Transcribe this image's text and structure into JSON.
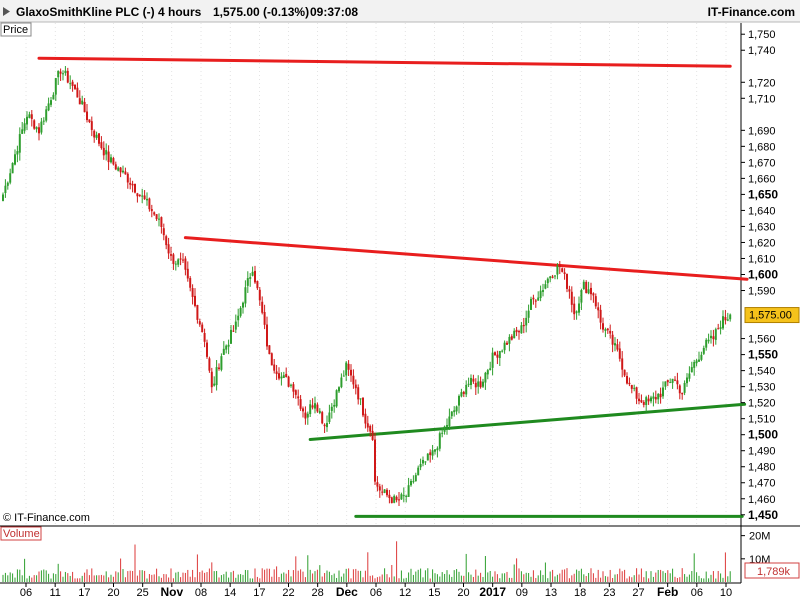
{
  "header": {
    "instrument": "GlaxoSmithKline PLC (-)",
    "timeframe": "4 hours",
    "change": "1,575.00 (-0.13%)",
    "time": "09:37:08",
    "brand": "IT-Finance.com"
  },
  "panels": {
    "price_label": "Price",
    "volume_label": "Volume"
  },
  "copyright": "© IT-Finance.com",
  "colors": {
    "up_candle": "#2e9e2e",
    "down_candle": "#d01818",
    "resistance": "#e81e1e",
    "support": "#1f8a1f",
    "last_price_bg": "#f5c21b",
    "volume_bar": "#dd3a3a",
    "volume_bar_up": "#2e9e2e",
    "volume_tag_border": "#d04040",
    "grid": "#c8c8c8"
  },
  "icons": {
    "scroll_arrow": "triangle-right-icon"
  },
  "chart_data": {
    "type": "candlestick",
    "price_axis": {
      "ylim": [
        1443,
        1757
      ],
      "ticks": [
        {
          "value": 1750,
          "label": "1,750",
          "bold": false
        },
        {
          "value": 1740,
          "label": "1,740",
          "bold": false
        },
        {
          "value": 1720,
          "label": "1,720",
          "bold": false
        },
        {
          "value": 1710,
          "label": "1,710",
          "bold": false
        },
        {
          "value": 1690,
          "label": "1,690",
          "bold": false
        },
        {
          "value": 1680,
          "label": "1,680",
          "bold": false
        },
        {
          "value": 1670,
          "label": "1,670",
          "bold": false
        },
        {
          "value": 1660,
          "label": "1,660",
          "bold": false
        },
        {
          "value": 1650,
          "label": "1,650",
          "bold": true
        },
        {
          "value": 1640,
          "label": "1,640",
          "bold": false
        },
        {
          "value": 1630,
          "label": "1,630",
          "bold": false
        },
        {
          "value": 1620,
          "label": "1,620",
          "bold": false
        },
        {
          "value": 1610,
          "label": "1,610",
          "bold": false
        },
        {
          "value": 1600,
          "label": "1,600",
          "bold": true
        },
        {
          "value": 1590,
          "label": "1,590",
          "bold": false
        },
        {
          "value": 1560,
          "label": "1,560",
          "bold": false
        },
        {
          "value": 1550,
          "label": "1,550",
          "bold": true
        },
        {
          "value": 1540,
          "label": "1,540",
          "bold": false
        },
        {
          "value": 1530,
          "label": "1,530",
          "bold": false
        },
        {
          "value": 1520,
          "label": "1,520",
          "bold": false
        },
        {
          "value": 1510,
          "label": "1,510",
          "bold": false
        },
        {
          "value": 1500,
          "label": "1,500",
          "bold": true
        },
        {
          "value": 1490,
          "label": "1,490",
          "bold": false
        },
        {
          "value": 1480,
          "label": "1,480",
          "bold": false
        },
        {
          "value": 1470,
          "label": "1,470",
          "bold": false
        },
        {
          "value": 1460,
          "label": "1,460",
          "bold": false
        },
        {
          "value": 1450,
          "label": "1,450",
          "bold": true
        }
      ],
      "last_price": {
        "value": 1575.0,
        "label": "1,575.00"
      }
    },
    "volume_axis": {
      "ylim": [
        0,
        22000000
      ],
      "ticks": [
        {
          "value": 20000000,
          "label": "20M"
        },
        {
          "value": 10000000,
          "label": "10M"
        }
      ],
      "last_volume": {
        "value": 1789000,
        "label": "1,789k"
      }
    },
    "x_axis": {
      "ticks": [
        {
          "label": "06",
          "bold": false
        },
        {
          "label": "11",
          "bold": false
        },
        {
          "label": "17",
          "bold": false
        },
        {
          "label": "20",
          "bold": false
        },
        {
          "label": "25",
          "bold": false
        },
        {
          "label": "Nov",
          "bold": true
        },
        {
          "label": "08",
          "bold": false
        },
        {
          "label": "14",
          "bold": false
        },
        {
          "label": "17",
          "bold": false
        },
        {
          "label": "22",
          "bold": false
        },
        {
          "label": "28",
          "bold": false
        },
        {
          "label": "Dec",
          "bold": true
        },
        {
          "label": "06",
          "bold": false
        },
        {
          "label": "12",
          "bold": false
        },
        {
          "label": "15",
          "bold": false
        },
        {
          "label": "20",
          "bold": false
        },
        {
          "label": "2017",
          "bold": true
        },
        {
          "label": "09",
          "bold": false
        },
        {
          "label": "13",
          "bold": false
        },
        {
          "label": "18",
          "bold": false
        },
        {
          "label": "23",
          "bold": false
        },
        {
          "label": "27",
          "bold": false
        },
        {
          "label": "Feb",
          "bold": true
        },
        {
          "label": "06",
          "bold": false
        },
        {
          "label": "10",
          "bold": false
        }
      ]
    },
    "price_path_anchors": [
      [
        0,
        1650
      ],
      [
        10,
        1700
      ],
      [
        15,
        1690
      ],
      [
        24,
        1728
      ],
      [
        28,
        1720
      ],
      [
        31,
        1712
      ],
      [
        38,
        1688
      ],
      [
        44,
        1672
      ],
      [
        52,
        1660
      ],
      [
        62,
        1640
      ],
      [
        66,
        1630
      ],
      [
        70,
        1610
      ],
      [
        75,
        1606
      ],
      [
        76,
        1600
      ],
      [
        80,
        1580
      ],
      [
        84,
        1560
      ],
      [
        87,
        1528
      ],
      [
        91,
        1550
      ],
      [
        97,
        1568
      ],
      [
        100,
        1585
      ],
      [
        104,
        1605
      ],
      [
        108,
        1575
      ],
      [
        111,
        1548
      ],
      [
        116,
        1536
      ],
      [
        121,
        1530
      ],
      [
        126,
        1512
      ],
      [
        130,
        1522
      ],
      [
        134,
        1506
      ],
      [
        140,
        1530
      ],
      [
        143,
        1542
      ],
      [
        147,
        1530
      ],
      [
        151,
        1510
      ],
      [
        154,
        1500
      ],
      [
        155,
        1470
      ],
      [
        158,
        1464
      ],
      [
        164,
        1458
      ],
      [
        168,
        1462
      ],
      [
        173,
        1478
      ],
      [
        179,
        1488
      ],
      [
        184,
        1504
      ],
      [
        189,
        1518
      ],
      [
        193,
        1532
      ],
      [
        199,
        1532
      ],
      [
        204,
        1548
      ],
      [
        210,
        1558
      ],
      [
        216,
        1566
      ],
      [
        220,
        1582
      ],
      [
        225,
        1592
      ],
      [
        228,
        1600
      ],
      [
        232,
        1605
      ],
      [
        236,
        1590
      ],
      [
        238,
        1576
      ],
      [
        242,
        1593
      ],
      [
        246,
        1588
      ],
      [
        249,
        1570
      ],
      [
        253,
        1560
      ],
      [
        257,
        1548
      ],
      [
        261,
        1530
      ],
      [
        265,
        1522
      ],
      [
        269,
        1520
      ],
      [
        274,
        1526
      ],
      [
        279,
        1536
      ],
      [
        283,
        1526
      ],
      [
        287,
        1542
      ],
      [
        292,
        1555
      ],
      [
        296,
        1560
      ],
      [
        299,
        1570
      ],
      [
        303,
        1575
      ]
    ],
    "trendlines": [
      {
        "name": "resistance-top",
        "color": "resistance",
        "from": {
          "index": 15,
          "price": 1735
        },
        "to": {
          "index": 303,
          "price": 1730
        }
      },
      {
        "name": "resistance-descending",
        "color": "resistance",
        "from": {
          "index": 76,
          "price": 1623
        },
        "to": {
          "index": 310,
          "price": 1597
        }
      },
      {
        "name": "support-ascending",
        "color": "support",
        "from": {
          "index": 128,
          "price": 1497
        },
        "to": {
          "index": 309,
          "price": 1519
        }
      },
      {
        "name": "support-bottom",
        "color": "support",
        "from": {
          "index": 147,
          "price": 1449
        },
        "to": {
          "index": 308,
          "price": 1449
        }
      }
    ]
  }
}
